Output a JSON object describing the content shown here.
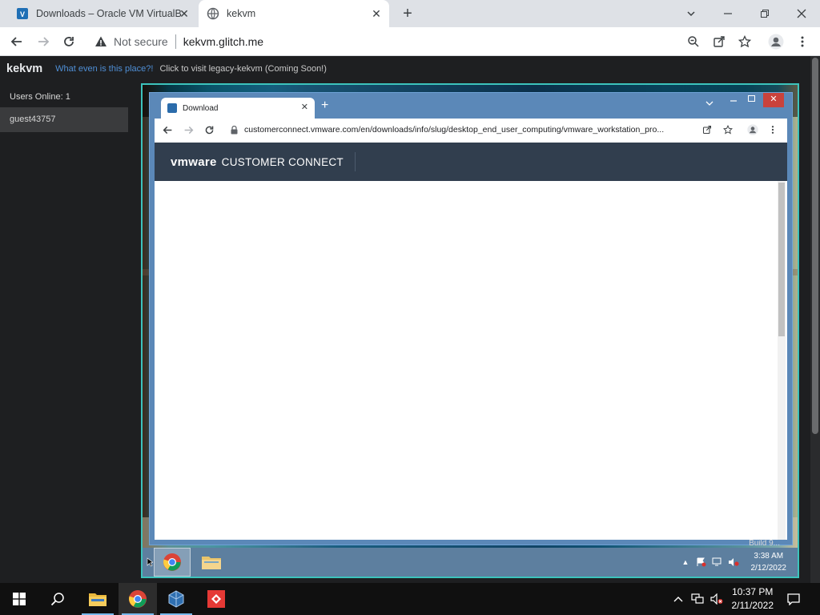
{
  "host_browser": {
    "tabs": [
      {
        "title": "Downloads – Oracle VM VirtualB",
        "active": false
      },
      {
        "title": "kekvm",
        "active": true
      }
    ],
    "address": {
      "security_label": "Not secure",
      "url": "kekvm.glitch.me"
    }
  },
  "kekvm_page": {
    "site_title": "kekvm",
    "what_link": "What even is this place?!",
    "legacy_link": "Click to visit legacy-kekvm (Coming Soon!)",
    "users_online": "Users Online: 1",
    "users": [
      "guest43757"
    ]
  },
  "vm_screen": {
    "guest_browser": {
      "tab_title": "Download",
      "url": "customerconnect.vmware.com/en/downloads/info/slug/desktop_end_user_computing/vmware_workstation_pro...",
      "brand_logo": "vmware",
      "brand_text": "CUSTOMER CONNECT"
    },
    "watermark": "Build 9...",
    "taskbar": {
      "time": "3:38 AM",
      "date": "2/12/2022"
    }
  },
  "host_taskbar": {
    "time": "10:37 PM",
    "date": "2/11/2022"
  },
  "colors": {
    "vm_border": "#3cc3bc",
    "vmware_header": "#313e4e",
    "guest_frame": "#5b88b8",
    "link_blue": "#4f8fd6"
  }
}
